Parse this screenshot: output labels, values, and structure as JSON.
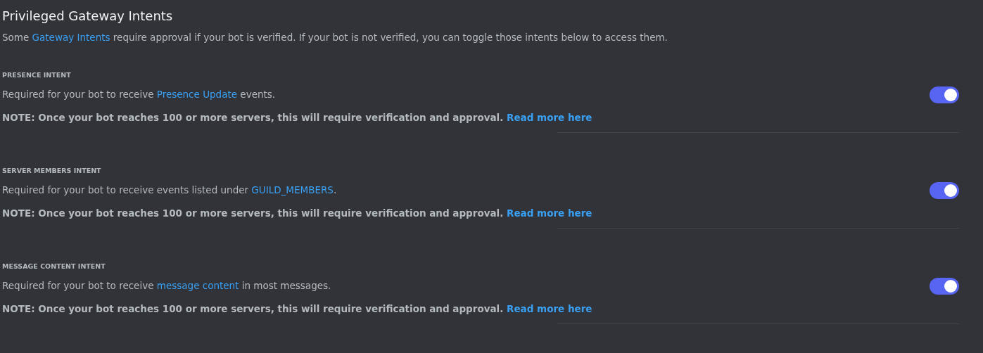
{
  "title": "Privileged Gateway Intents",
  "intro": {
    "before": "Some ",
    "link": "Gateway Intents",
    "after": " require approval if your bot is verified. If your bot is not verified, you can toggle those intents below to access them."
  },
  "intents": [
    {
      "heading": "PRESENCE INTENT",
      "description": {
        "before": "Required for your bot to receive ",
        "link": "Presence Update",
        "after": " events."
      },
      "note": "NOTE: Once your bot reaches 100 or more servers, this will require verification and approval.",
      "note_link": "Read more here",
      "on": true
    },
    {
      "heading": "SERVER MEMBERS INTENT",
      "description": {
        "before": "Required for your bot to receive events listed under ",
        "link": "GUILD_MEMBERS",
        "after": "."
      },
      "note": "NOTE: Once your bot reaches 100 or more servers, this will require verification and approval.",
      "note_link": "Read more here",
      "on": true
    },
    {
      "heading": "MESSAGE CONTENT INTENT",
      "description": {
        "before": "Required for your bot to receive ",
        "link": "message content",
        "after": " in most messages."
      },
      "note": "NOTE: Once your bot reaches 100 or more servers, this will require verification and approval.",
      "note_link": "Read more here",
      "on": true
    }
  ]
}
